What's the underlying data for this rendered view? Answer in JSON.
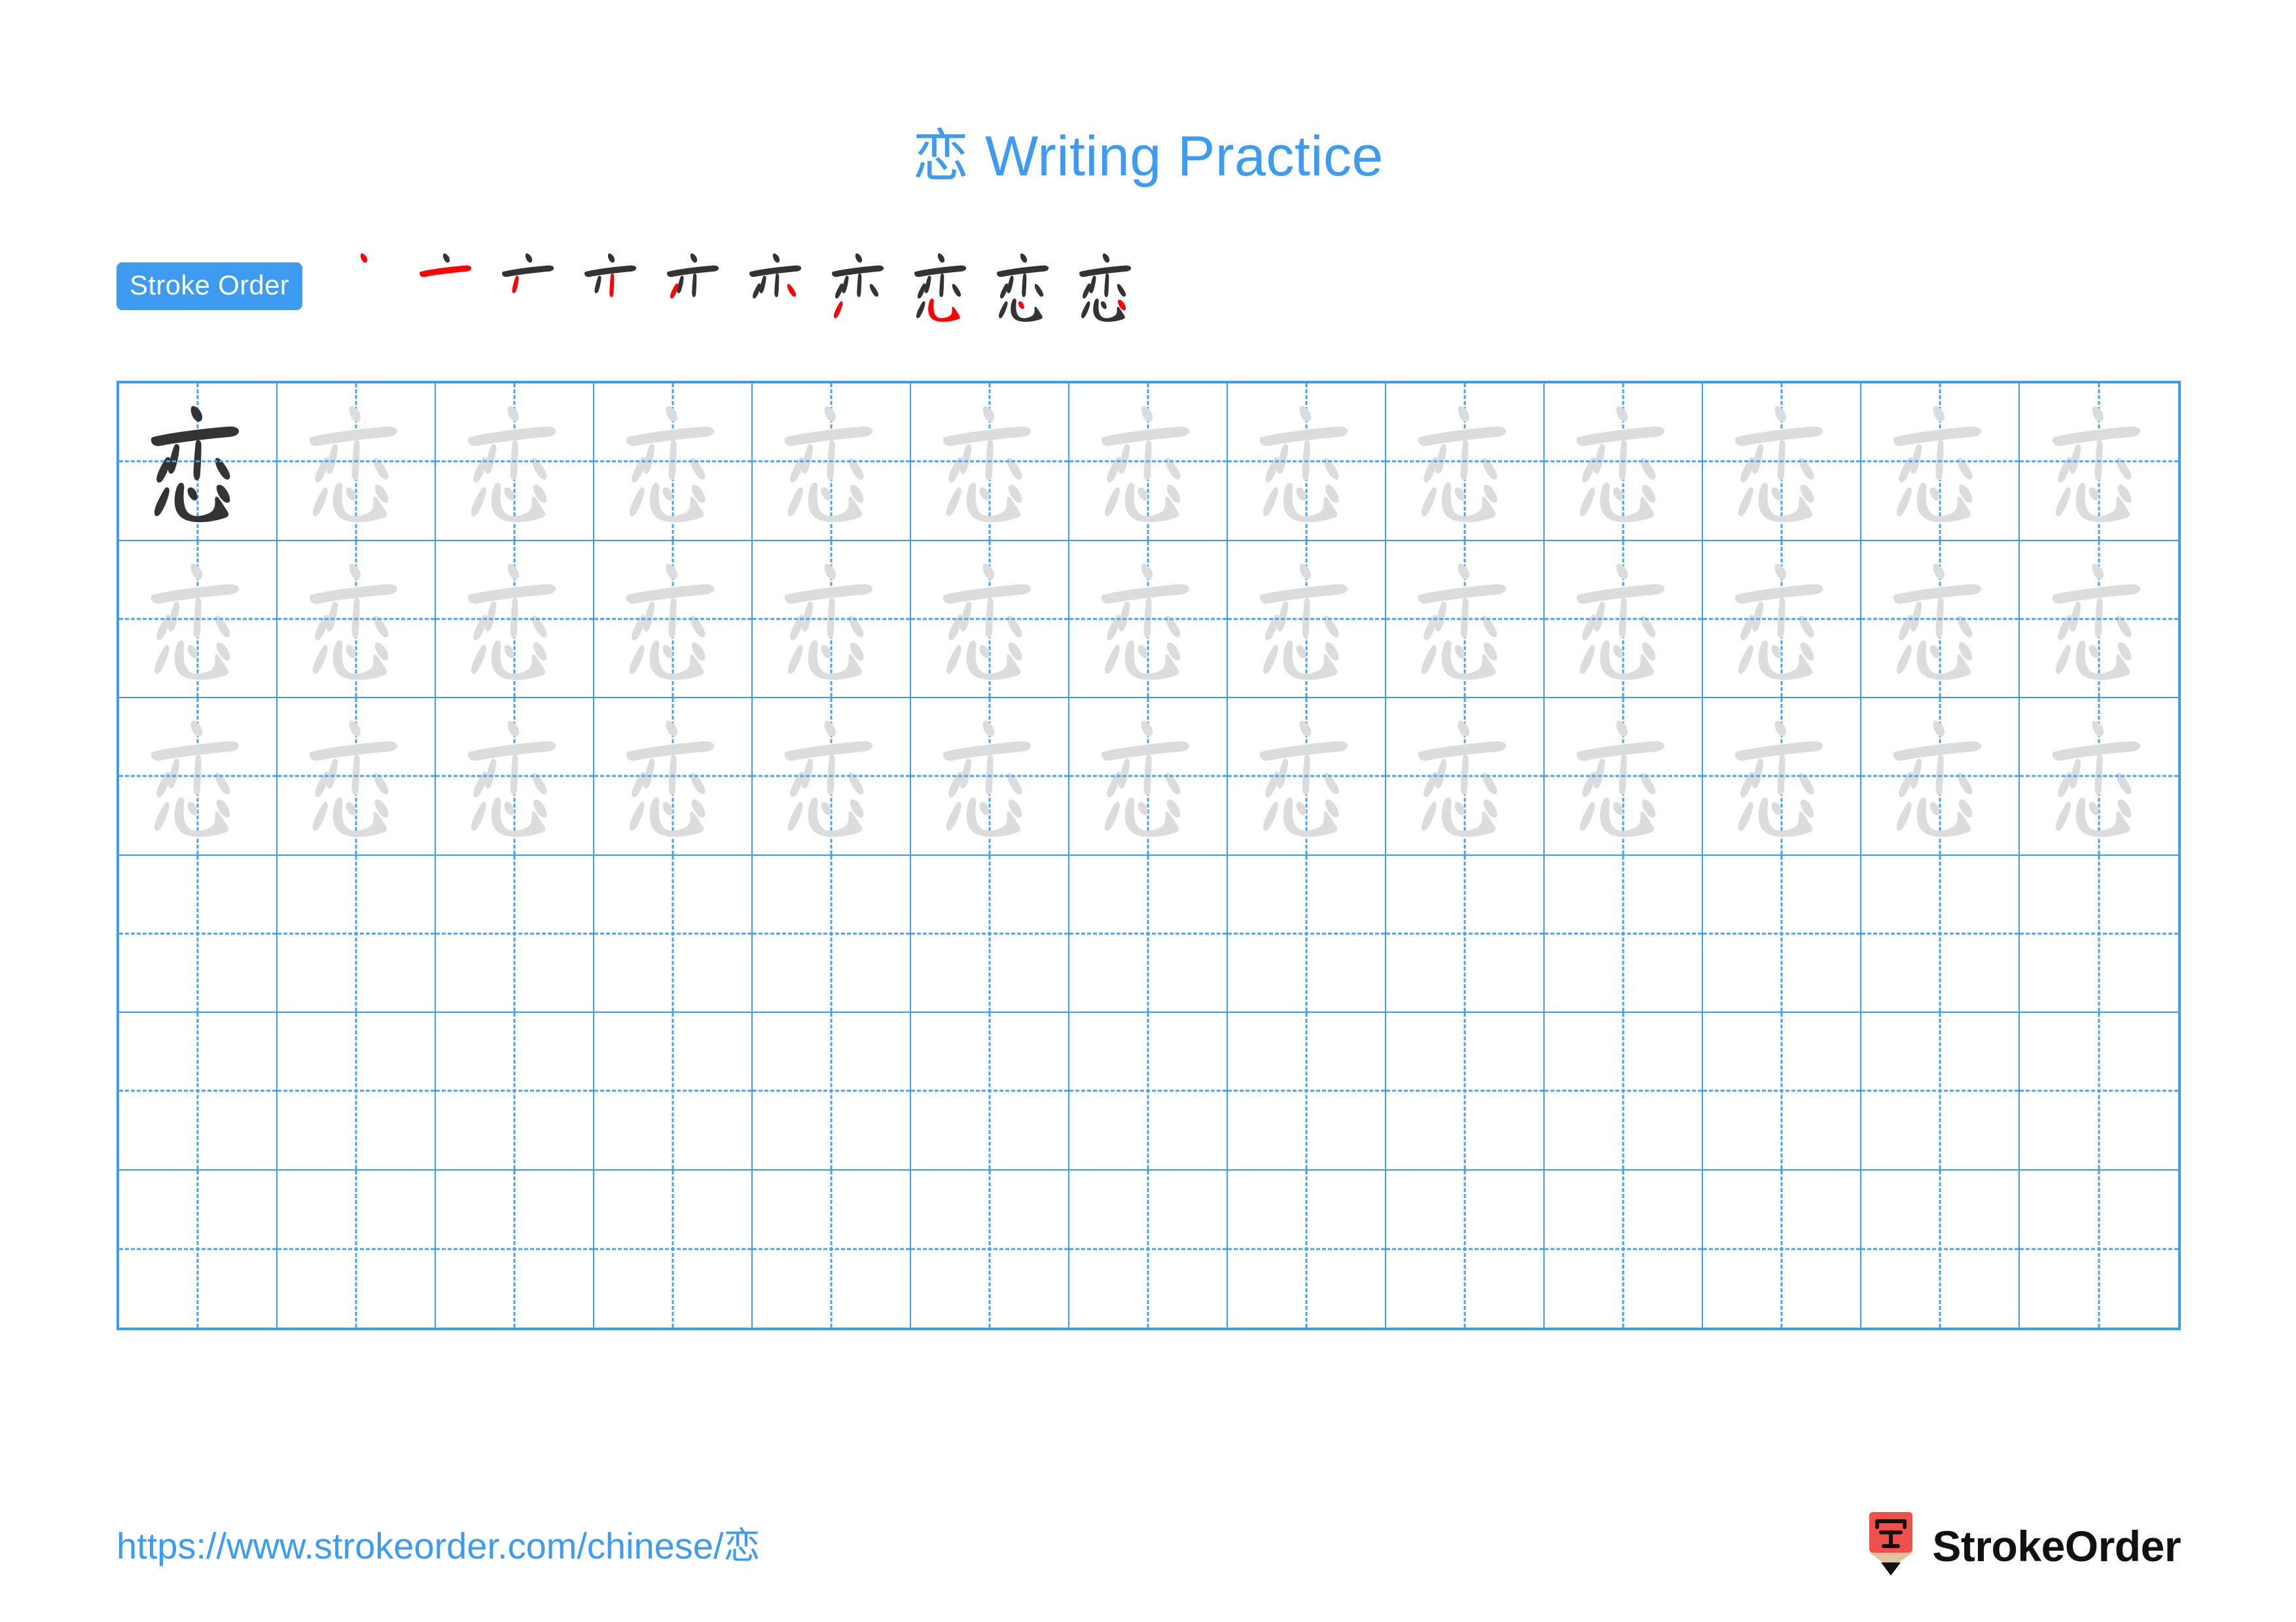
{
  "page": {
    "title_character": "恋",
    "title_text": "Writing Practice",
    "title_full": "恋 Writing Practice",
    "accent_blue": "#3d9bf0",
    "stroke_highlight_red": "#ff0000",
    "stroke_dark": "#333333",
    "trace_gray": "#dcdcdc",
    "background": "#ffffff"
  },
  "stroke_order": {
    "badge_label": "Stroke Order",
    "character": "恋",
    "total_strokes": 10,
    "steps": [
      {
        "index": 1,
        "cumulative_strokes": 1,
        "new_stroke_color": "#ff0000"
      },
      {
        "index": 2,
        "cumulative_strokes": 2,
        "new_stroke_color": "#ff0000"
      },
      {
        "index": 3,
        "cumulative_strokes": 3,
        "new_stroke_color": "#ff0000"
      },
      {
        "index": 4,
        "cumulative_strokes": 4,
        "new_stroke_color": "#ff0000"
      },
      {
        "index": 5,
        "cumulative_strokes": 5,
        "new_stroke_color": "#ff0000"
      },
      {
        "index": 6,
        "cumulative_strokes": 6,
        "new_stroke_color": "#ff0000"
      },
      {
        "index": 7,
        "cumulative_strokes": 7,
        "new_stroke_color": "#ff0000"
      },
      {
        "index": 8,
        "cumulative_strokes": 8,
        "new_stroke_color": "#ff0000"
      },
      {
        "index": 9,
        "cumulative_strokes": 9,
        "new_stroke_color": "#ff0000"
      },
      {
        "index": 10,
        "cumulative_strokes": 10,
        "new_stroke_color": "#ff0000"
      }
    ]
  },
  "practice_grid": {
    "columns": 13,
    "rows": 6,
    "character": "恋",
    "grid_line_color": "#3d9bf0",
    "guide_line_style": "dashed-cross",
    "row_fill": [
      {
        "row": 1,
        "cells": [
          "dark",
          "trace",
          "trace",
          "trace",
          "trace",
          "trace",
          "trace",
          "trace",
          "trace",
          "trace",
          "trace",
          "trace",
          "trace"
        ]
      },
      {
        "row": 2,
        "cells": [
          "trace",
          "trace",
          "trace",
          "trace",
          "trace",
          "trace",
          "trace",
          "trace",
          "trace",
          "trace",
          "trace",
          "trace",
          "trace"
        ]
      },
      {
        "row": 3,
        "cells": [
          "trace",
          "trace",
          "trace",
          "trace",
          "trace",
          "trace",
          "trace",
          "trace",
          "trace",
          "trace",
          "trace",
          "trace",
          "trace"
        ]
      },
      {
        "row": 4,
        "cells": [
          "empty",
          "empty",
          "empty",
          "empty",
          "empty",
          "empty",
          "empty",
          "empty",
          "empty",
          "empty",
          "empty",
          "empty",
          "empty"
        ]
      },
      {
        "row": 5,
        "cells": [
          "empty",
          "empty",
          "empty",
          "empty",
          "empty",
          "empty",
          "empty",
          "empty",
          "empty",
          "empty",
          "empty",
          "empty",
          "empty"
        ]
      },
      {
        "row": 6,
        "cells": [
          "empty",
          "empty",
          "empty",
          "empty",
          "empty",
          "empty",
          "empty",
          "empty",
          "empty",
          "empty",
          "empty",
          "empty",
          "empty"
        ]
      }
    ]
  },
  "footer": {
    "url": "https://www.strokeorder.com/chinese/恋",
    "brand_name": "StrokeOrder",
    "logo_character": "字",
    "logo_body_color": "#f0504a",
    "logo_wood_color": "#e2c3a0",
    "logo_tip_color": "#111111"
  }
}
